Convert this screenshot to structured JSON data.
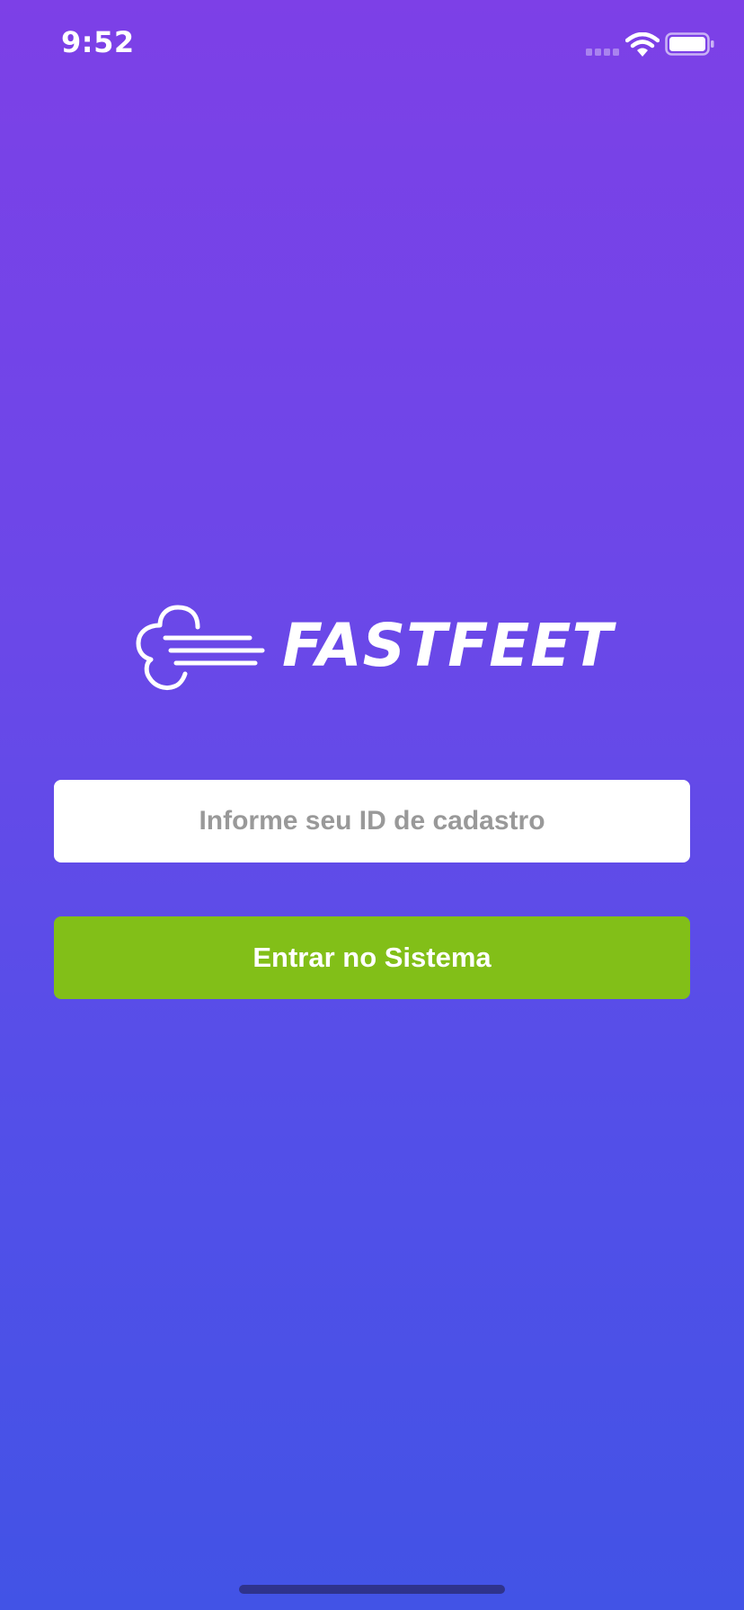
{
  "status_bar": {
    "time": "9:52",
    "icons": [
      "signal-icon",
      "wifi-icon",
      "battery-icon"
    ]
  },
  "logo": {
    "wordmark": "FASTFEET",
    "icon": "cloud-speed-icon"
  },
  "login_form": {
    "id_placeholder": "Informe seu ID de cadastro",
    "id_value": "",
    "submit_label": "Entrar no Sistema"
  },
  "colors": {
    "background_top": "#7d40e7",
    "background_bottom": "#4253e6",
    "button": "#82bf18",
    "placeholder": "#999999"
  }
}
